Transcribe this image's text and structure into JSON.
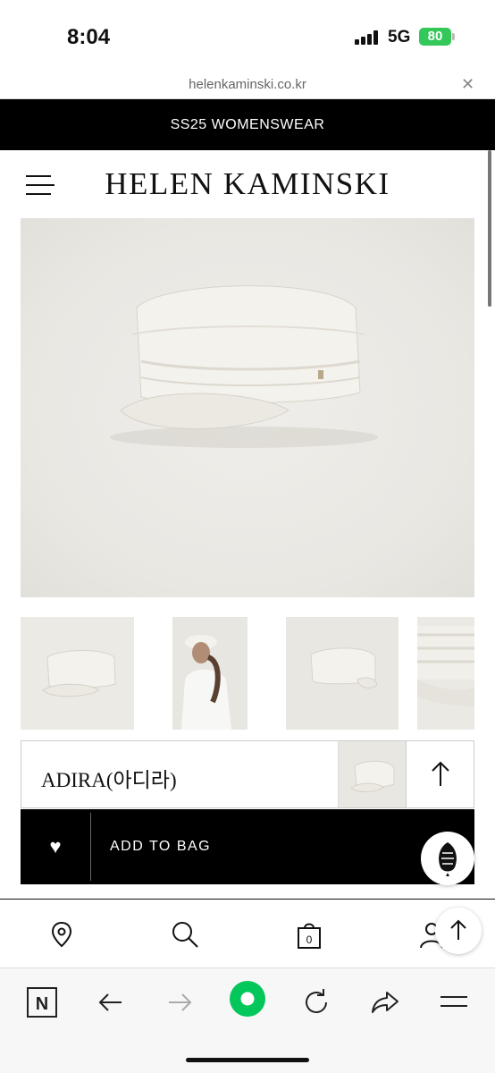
{
  "status_bar": {
    "time": "8:04",
    "network": "5G",
    "battery": "80"
  },
  "browser": {
    "url": "helenkaminski.co.kr",
    "close_icon": "close-icon"
  },
  "promo": {
    "text": "SS25 WOMENSWEAR"
  },
  "header": {
    "logo": "HELEN KAMINSKI",
    "menu_icon": "hamburger-icon"
  },
  "product": {
    "name": "ADIRA(아디라)",
    "add_to_bag": "ADD TO BAG",
    "wishlist_icon": "heart-icon",
    "scroll_up_icon": "arrow-up-icon"
  },
  "site_nav": {
    "items": [
      "location-pin-icon",
      "search-icon",
      "shopping-bag-icon",
      "account-icon"
    ],
    "bag_count": "0"
  },
  "browser_toolbar": {
    "items": [
      "naver-icon",
      "back-arrow-icon",
      "forward-arrow-icon",
      "home-icon",
      "reload-icon",
      "share-icon",
      "menu-icon"
    ],
    "naver_letter": "N"
  },
  "colors": {
    "black": "#000000",
    "accent_green": "#03c75a",
    "battery_green": "#34c759"
  }
}
